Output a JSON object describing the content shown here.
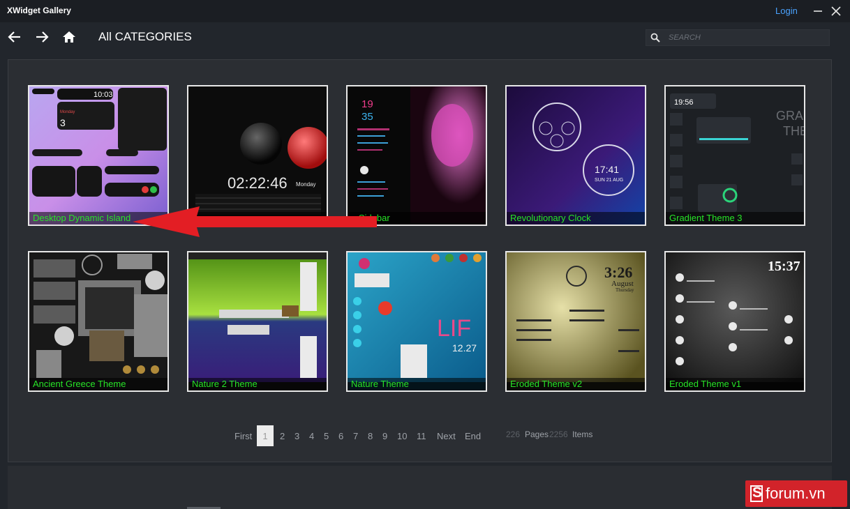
{
  "window": {
    "title": "XWidget Gallery",
    "login_label": "Login"
  },
  "toolbar": {
    "back_icon": "arrow-left-icon",
    "forward_icon": "arrow-right-icon",
    "home_icon": "home-icon",
    "category_title": "All CATEGORIES",
    "search_placeholder": "SEARCH",
    "search_value": ""
  },
  "gallery": {
    "items": [
      {
        "label": "Desktop Dynamic Island"
      },
      {
        "label": ""
      },
      {
        "label": "e Sidebar"
      },
      {
        "label": "Revolutionary Clock"
      },
      {
        "label": "Gradient Theme 3"
      },
      {
        "label": "Ancient Greece Theme"
      },
      {
        "label": "Nature 2 Theme"
      },
      {
        "label": "Nature Theme"
      },
      {
        "label": "Eroded Theme v2"
      },
      {
        "label": "Eroded Theme v1"
      }
    ],
    "thumb_texts": {
      "island_time": "10:03",
      "island_day": "Monday",
      "island_date": "3",
      "clock_time": "02:22:46",
      "clock_day": "Monday",
      "sidebar_hour": "19",
      "sidebar_min": "35",
      "rev_time": "17:41",
      "rev_date": "SUN 21 AUG",
      "grad_time": "19:56",
      "grad_big": "GRAD",
      "grad_big2": "THE",
      "eroded2_time": "3:26",
      "eroded2_month": "August",
      "eroded2_day": "Thursday",
      "eroded1_time": "15:37",
      "nature_big": "LIF",
      "nature_year": "12.27"
    }
  },
  "pagination": {
    "first": "First",
    "current": "1",
    "pages": [
      "2",
      "3",
      "4",
      "5",
      "6",
      "7",
      "8",
      "9",
      "10",
      "11"
    ],
    "next": "Next",
    "end": "End",
    "total_pages": "226",
    "pages_label": "Pages",
    "total_items": "2256",
    "items_label": "Items"
  },
  "watermark": {
    "text": "forum.vn",
    "badge": "S"
  },
  "colors": {
    "accent_link": "#4aa3ff",
    "tile_label": "#27e427",
    "arrow": "#e31e24",
    "watermark_bg": "#d2232a"
  }
}
